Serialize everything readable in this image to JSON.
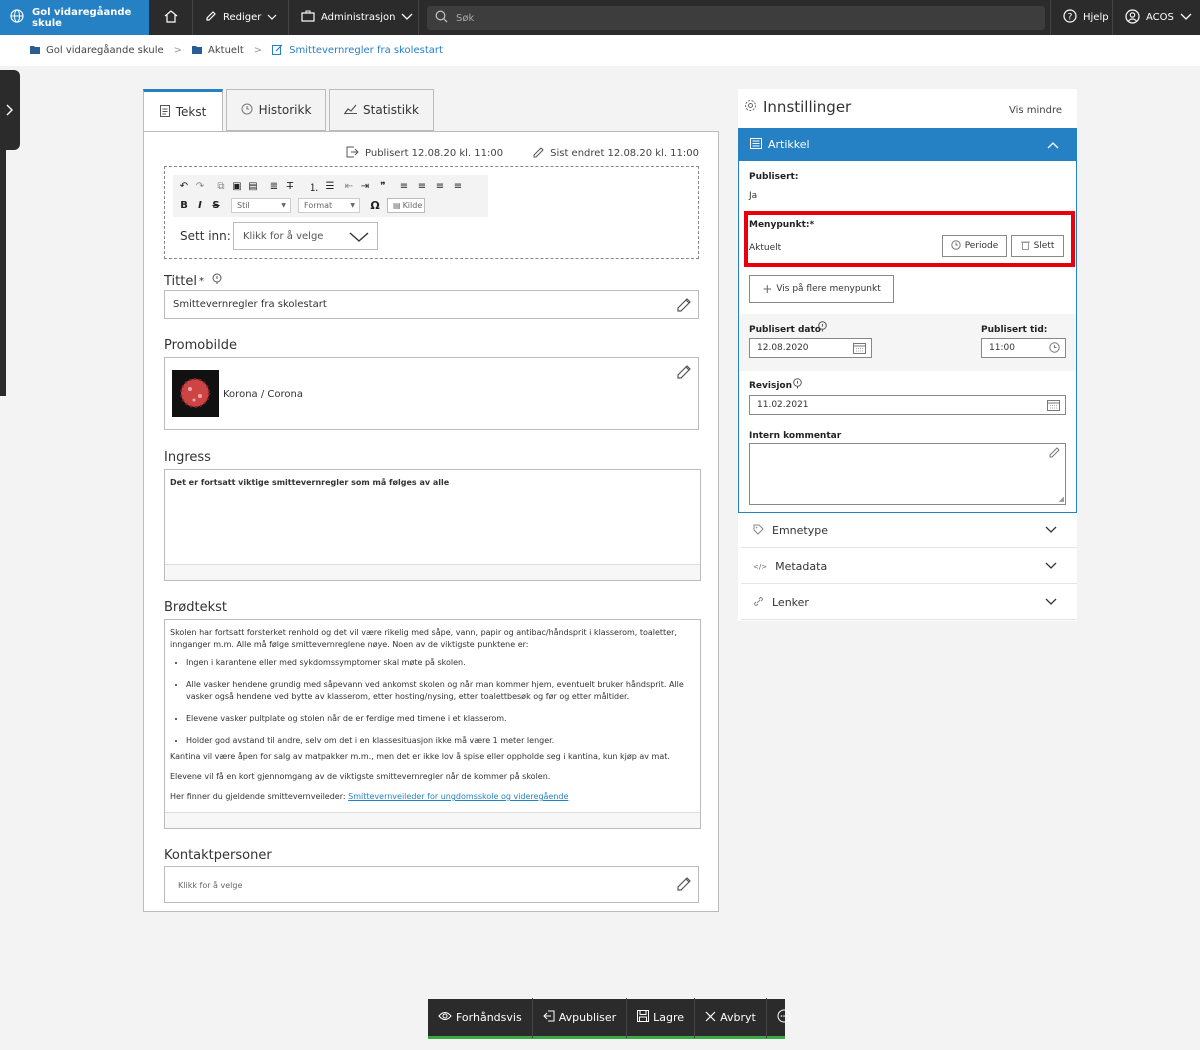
{
  "topbar": {
    "site_name": "Gol vidaregåande skule",
    "edit_label": "Rediger",
    "admin_label": "Administrasjon",
    "search_placeholder": "Søk",
    "help_label": "Hjelp",
    "user_label": "ACOS"
  },
  "breadcrumb": {
    "items": [
      "Gol vidaregåande skule",
      "Aktuelt",
      "Smittevernregler fra skolestart"
    ],
    "separator": ">"
  },
  "tabs": [
    {
      "label": "Tekst",
      "icon": "document-icon",
      "active": true
    },
    {
      "label": "Historikk",
      "icon": "clock-icon",
      "active": false
    },
    {
      "label": "Statistikk",
      "icon": "chart-icon",
      "active": false
    }
  ],
  "editor": {
    "published_label": "Publisert 12.08.20 kl. 11:00",
    "last_changed_label": "Sist endret 12.08.20 kl. 11:00",
    "toolbar": {
      "style_dropdown": "Stil",
      "format_dropdown": "Format",
      "omega": "Ω",
      "source_label": "Kilde",
      "bold": "B",
      "italic": "I",
      "strike": "S",
      "quote": "❞"
    },
    "insert_label": "Sett inn:",
    "insert_placeholder": "Klikk for å velge",
    "title_label": "Tittel",
    "title_required": "*",
    "title_value": "Smittevernregler fra skolestart",
    "promo_label": "Promobilde",
    "promo_caption": "Korona / Corona",
    "ingress_label": "Ingress",
    "ingress_text": "Det er fortsatt viktige smittevernregler som må følges av alle",
    "body_label": "Brødtekst",
    "body_intro": "Skolen har fortsatt forsterket renhold og det vil være rikelig med såpe, vann, papir og antibac/håndsprit i klasserom, toaletter, innganger m.m. Alle må følge smittevernreglene nøye. Noen av de viktigste punktene er:",
    "body_bullets": [
      "Ingen i karantene eller med sykdomssymptomer skal møte på skolen.",
      "Alle vasker hendene grundig med såpevann ved ankomst skolen og når man kommer hjem, eventuelt bruker håndsprit. Alle vasker også hendene ved bytte av klasserom, etter hosting/nysing, etter toalettbesøk og før og etter måltider.",
      "Elevene vasker pultplate og stolen når de er ferdige med timene i et klasserom.",
      "Holder god avstand til andre, selv om det i en klassesituasjon ikke må være 1 meter lenger."
    ],
    "body_p1": "Kantina vil være åpen for salg av matpakker m.m., men det er ikke lov å spise eller oppholde seg i kantina, kun kjøp av mat.",
    "body_p2": "Elevene vil få en kort gjennomgang av de viktigste smittevernregler når de kommer på skolen.",
    "body_p3_prefix": "Her finner du gjeldende smittevernveileder:",
    "body_p3_link": "Smittevernveileder for ungdomsskole og videregående",
    "contact_label": "Kontaktpersoner",
    "contact_placeholder": "Klikk for å velge"
  },
  "settings": {
    "title": "Innstillinger",
    "show_less": "Vis mindre",
    "article_section": "Artikkel",
    "published_label": "Publisert:",
    "published_value": "Ja",
    "menu_label": "Menypunkt:*",
    "menu_value": "Aktuelt",
    "period_button": "Periode",
    "delete_button": "Slett",
    "show_more_menu": "Vis på flere menypunkt",
    "pub_date_label": "Publisert dato",
    "pub_date_value": "12.08.2020",
    "pub_time_label": "Publisert tid:",
    "pub_time_value": "11:00",
    "revision_label": "Revisjon",
    "revision_value": "11.02.2021",
    "comment_label": "Intern kommentar",
    "comment_value": "",
    "accordion": [
      "Emnetype",
      "Metadata",
      "Lenker"
    ]
  },
  "bottombar": {
    "preview": "Forhåndsvis",
    "unpublish": "Avpubliser",
    "save": "Lagre",
    "cancel": "Avbryt"
  },
  "colors": {
    "accent": "#2581c4",
    "topbar": "#2b2b2b",
    "highlight": "#e8000a",
    "save_bar": "#39a845"
  }
}
